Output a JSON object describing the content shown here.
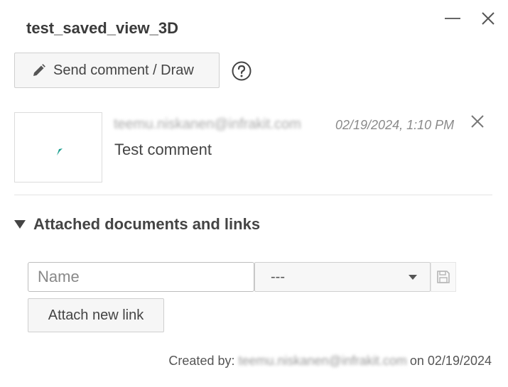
{
  "window": {
    "title": "test_saved_view_3D"
  },
  "toolbar": {
    "send_label": "Send comment / Draw",
    "help_icon": "question-circle-icon"
  },
  "comment": {
    "author": "teemu.niskanen@infrakit.com",
    "date": "02/19/2024, 1:10 PM",
    "text": "Test comment",
    "cursor_color": "#1a9e8f"
  },
  "attachments": {
    "heading": "Attached documents and links",
    "name_placeholder": "Name",
    "type_selected": "---",
    "attach_label": "Attach new link"
  },
  "footer": {
    "created_by_label": "Created by:",
    "creator": "teemu.niskanen@infrakit.com",
    "on_label": "on",
    "created_date": "02/19/2024"
  }
}
